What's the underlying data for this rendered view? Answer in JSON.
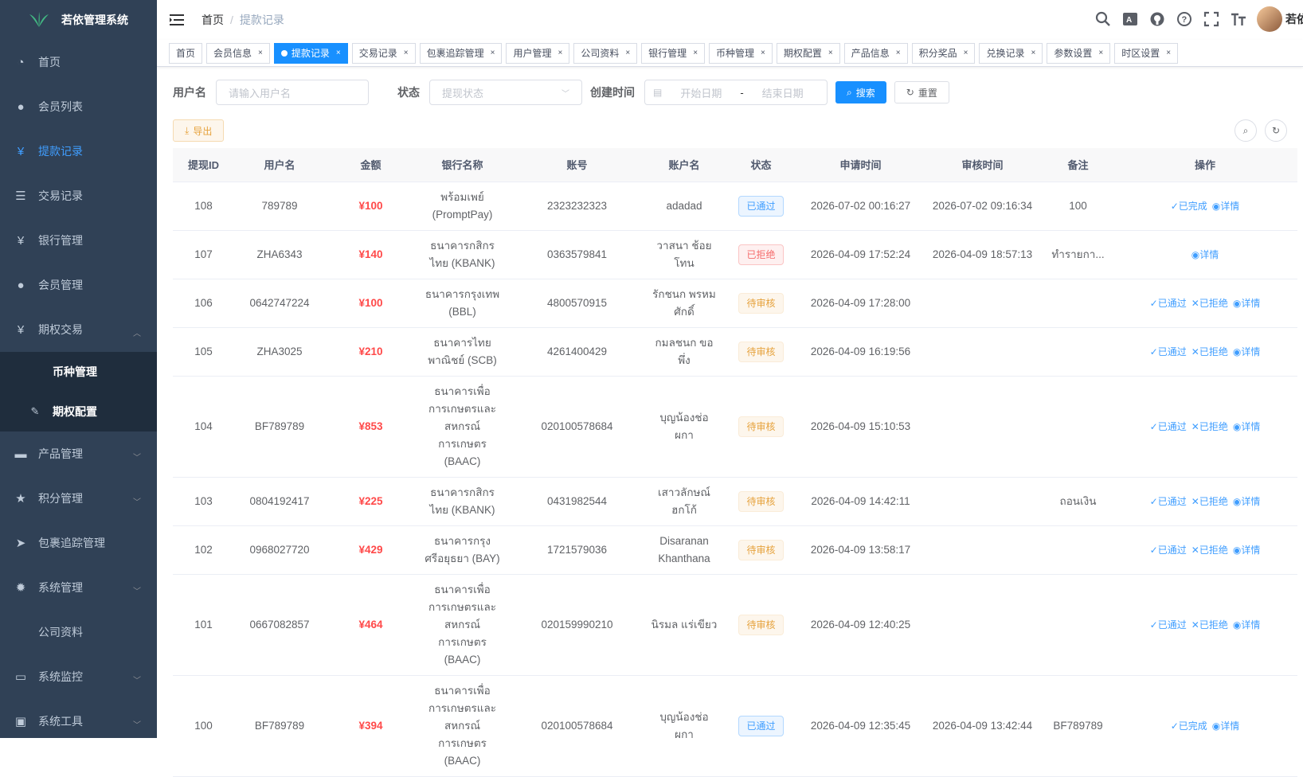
{
  "app": {
    "title": "若依管理系统"
  },
  "sidebar": {
    "items": [
      {
        "label": "首页",
        "icon": "dashboard-icon"
      },
      {
        "label": "会员列表",
        "icon": "user-icon"
      },
      {
        "label": "提款记录",
        "icon": "yen-icon"
      },
      {
        "label": "交易记录",
        "icon": "list-icon"
      },
      {
        "label": "银行管理",
        "icon": "yen-icon"
      },
      {
        "label": "会员管理",
        "icon": "peoples-icon"
      },
      {
        "label": "期权交易",
        "icon": "yen-icon"
      }
    ],
    "submenu": [
      {
        "label": "币种管理"
      },
      {
        "label": "期权配置"
      }
    ],
    "items2": [
      {
        "label": "产品管理",
        "icon": "cart-icon"
      },
      {
        "label": "积分管理",
        "icon": "star-icon"
      },
      {
        "label": "包裹追踪管理",
        "icon": "send-icon"
      },
      {
        "label": "系统管理",
        "icon": "gear-icon"
      },
      {
        "label": "公司资料",
        "icon": ""
      },
      {
        "label": "系统监控",
        "icon": "monitor-icon"
      },
      {
        "label": "系统工具",
        "icon": "tool-icon"
      }
    ]
  },
  "breadcrumb": {
    "home": "首页",
    "sep": "/",
    "current": "提款记录"
  },
  "user": {
    "name": "若依"
  },
  "tags": [
    "首页",
    "会员信息",
    "提款记录",
    "交易记录",
    "包裹追踪管理",
    "用户管理",
    "公司资料",
    "银行管理",
    "币种管理",
    "期权配置",
    "产品信息",
    "积分奖品",
    "兑换记录",
    "参数设置",
    "时区设置"
  ],
  "search": {
    "username_label": "用户名",
    "username_placeholder": "请输入用户名",
    "status_label": "状态",
    "status_placeholder": "提现状态",
    "time_label": "创建时间",
    "start_placeholder": "开始日期",
    "range_sep": "-",
    "end_placeholder": "结束日期",
    "search_btn": "搜索",
    "reset_btn": "重置"
  },
  "toolbar": {
    "export_label": "导出"
  },
  "table": {
    "headers": [
      "提现ID",
      "用户名",
      "金额",
      "银行名称",
      "账号",
      "账户名",
      "状态",
      "申请时间",
      "审核时间",
      "备注",
      "操作"
    ],
    "rows": [
      {
        "id": "108",
        "user": "789789",
        "amount": "¥100",
        "bank": "พร้อมเพย์ (PromptPay)",
        "account": "2323232323",
        "holder": "adadad",
        "status": "已通过",
        "st": "blue",
        "apply": "2026-07-02 00:16:27",
        "audit": "2026-07-02 09:16:34",
        "remark": "100",
        "ops": [
          "已完成",
          "详情"
        ]
      },
      {
        "id": "107",
        "user": "ZHA6343",
        "amount": "¥140",
        "bank": "ธนาคารกสิกรไทย (KBANK)",
        "account": "0363579841",
        "holder": "วาสนา ช้อยโทน",
        "status": "已拒绝",
        "st": "red",
        "apply": "2026-04-09 17:52:24",
        "audit": "2026-04-09 18:57:13",
        "remark": "ทำรายกา...",
        "ops": [
          "详情"
        ]
      },
      {
        "id": "106",
        "user": "0642747224",
        "amount": "¥100",
        "bank": "ธนาคารกรุงเทพ (BBL)",
        "account": "4800570915",
        "holder": "รักชนก พรหมศักดิ์",
        "status": "待审核",
        "st": "yellow",
        "apply": "2026-04-09 17:28:00",
        "audit": "",
        "remark": "",
        "ops": [
          "已通过",
          "已拒绝",
          "详情"
        ]
      },
      {
        "id": "105",
        "user": "ZHA3025",
        "amount": "¥210",
        "bank": "ธนาคารไทยพาณิชย์ (SCB)",
        "account": "4261400429",
        "holder": "กมลชนก ขอพึ่ง",
        "status": "待审核",
        "st": "yellow",
        "apply": "2026-04-09 16:19:56",
        "audit": "",
        "remark": "",
        "ops": [
          "已通过",
          "已拒绝",
          "详情"
        ]
      },
      {
        "id": "104",
        "user": "BF789789",
        "amount": "¥853",
        "bank": "ธนาคารเพื่อการเกษตรและสหกรณ์การเกษตร (BAAC)",
        "account": "020100578684",
        "holder": "บุญน้องช่อผกา",
        "status": "待审核",
        "st": "yellow",
        "apply": "2026-04-09 15:10:53",
        "audit": "",
        "remark": "",
        "ops": [
          "已通过",
          "已拒绝",
          "详情"
        ]
      },
      {
        "id": "103",
        "user": "0804192417",
        "amount": "¥225",
        "bank": "ธนาคารกสิกรไทย (KBANK)",
        "account": "0431982544",
        "holder": "เสาวลักษณ์ ฮกโก้",
        "status": "待审核",
        "st": "yellow",
        "apply": "2026-04-09 14:42:11",
        "audit": "",
        "remark": "ถอนเงิน",
        "ops": [
          "已通过",
          "已拒绝",
          "详情"
        ]
      },
      {
        "id": "102",
        "user": "0968027720",
        "amount": "¥429",
        "bank": "ธนาคารกรุงศรีอยุธยา (BAY)",
        "account": "1721579036",
        "holder": "Disaranan Khanthana",
        "status": "待审核",
        "st": "yellow",
        "apply": "2026-04-09 13:58:17",
        "audit": "",
        "remark": "",
        "ops": [
          "已通过",
          "已拒绝",
          "详情"
        ]
      },
      {
        "id": "101",
        "user": "0667082857",
        "amount": "¥464",
        "bank": "ธนาคารเพื่อการเกษตรและสหกรณ์การเกษตร (BAAC)",
        "account": "020159990210",
        "holder": "นิรมล แร่เขียว",
        "status": "待审核",
        "st": "yellow",
        "apply": "2026-04-09 12:40:25",
        "audit": "",
        "remark": "",
        "ops": [
          "已通过",
          "已拒绝",
          "详情"
        ]
      },
      {
        "id": "100",
        "user": "BF789789",
        "amount": "¥394",
        "bank": "ธนาคารเพื่อการเกษตรและสหกรณ์การเกษตร (BAAC)",
        "account": "020100578684",
        "holder": "บุญน้องช่อผกา",
        "status": "已通过",
        "st": "blue",
        "apply": "2026-04-09 12:35:45",
        "audit": "2026-04-09 13:42:44",
        "remark": "BF789789",
        "ops": [
          "已完成",
          "详情"
        ]
      }
    ]
  }
}
